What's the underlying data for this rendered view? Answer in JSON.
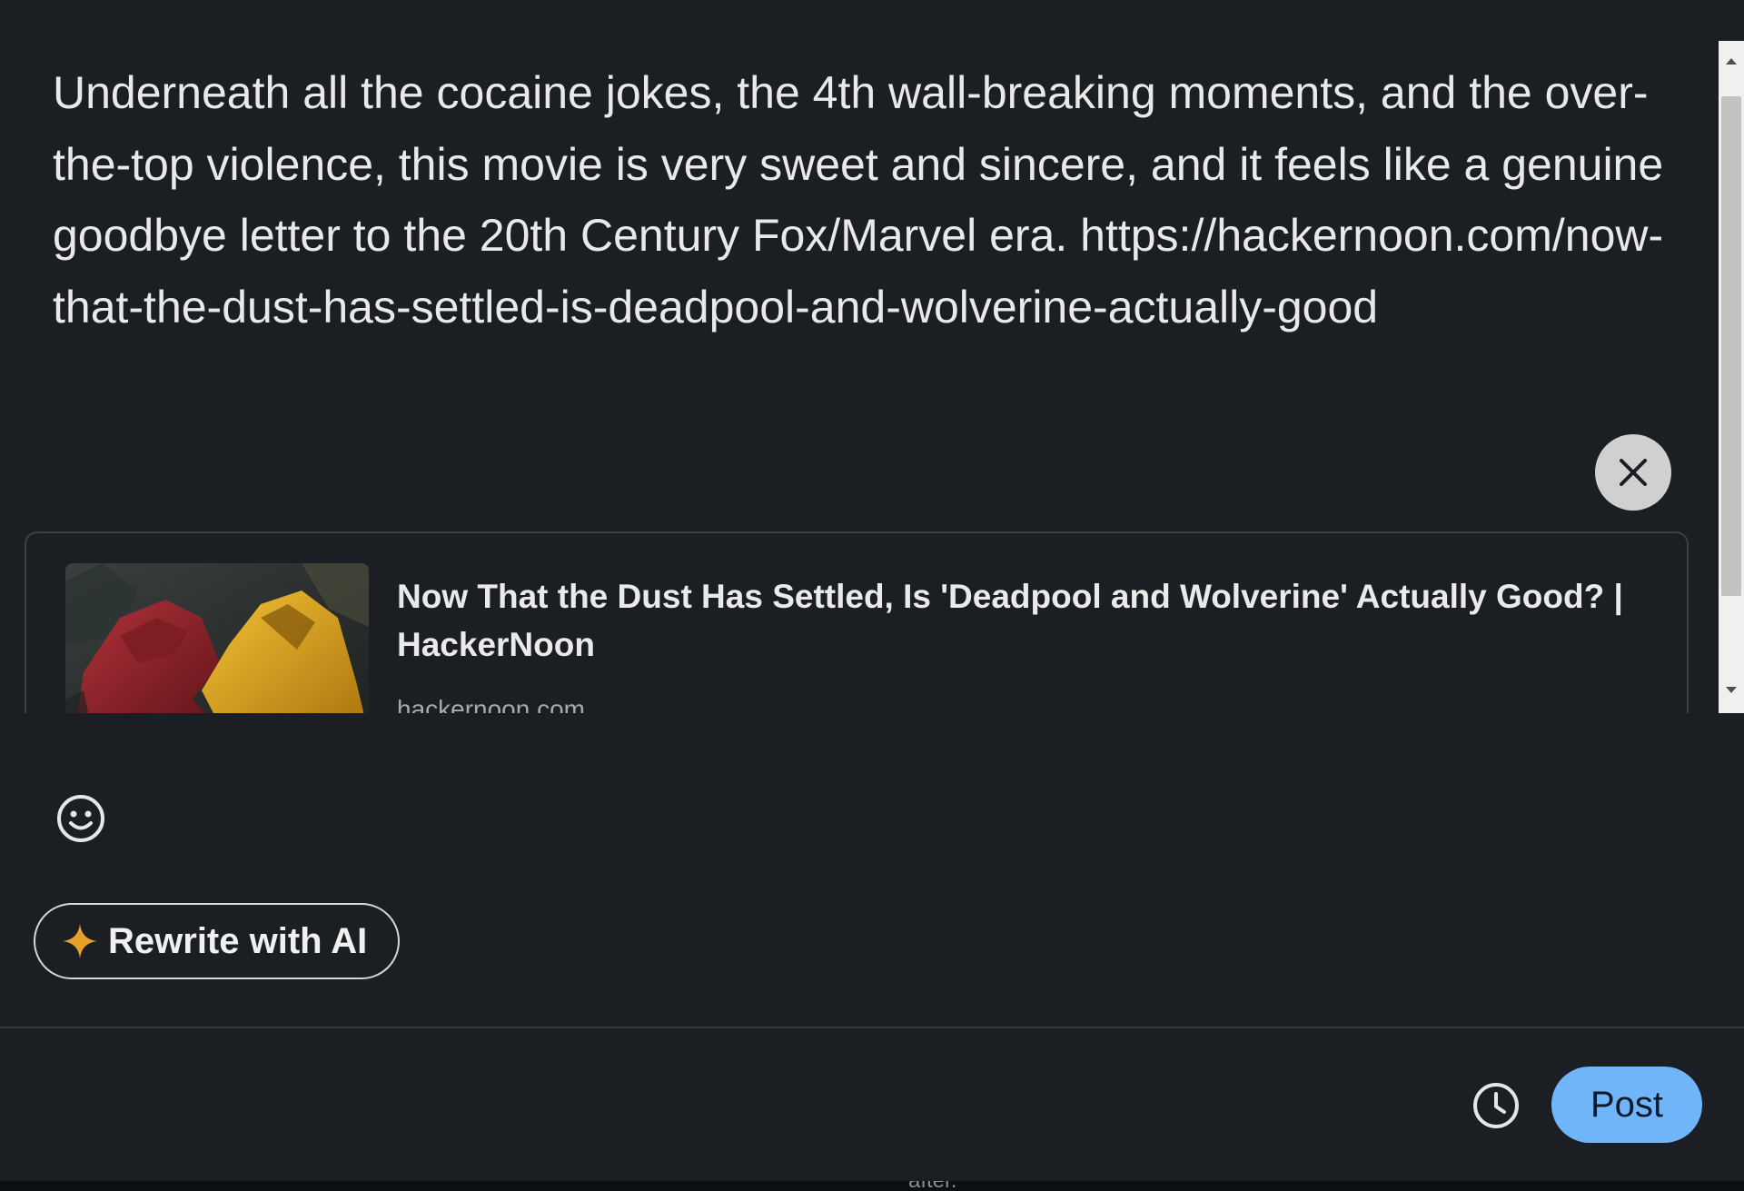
{
  "post": {
    "text": "Underneath all the cocaine jokes, the 4th wall-breaking moments, and the over-the-top violence, this movie is very sweet and sincere, and it feels like a genuine goodbye letter to the 20th Century Fox/Marvel era. https://hackernoon.com/now-that-the-dust-has-settled-is-deadpool-and-wolverine-actually-good"
  },
  "link_preview": {
    "title": "Now That the Dust Has Settled, Is 'Deadpool and Wolverine' Actually Good? | HackerNoon",
    "domain": "hackernoon.com",
    "thumbnail_icon": "deadpool-wolverine-heart-hands-image",
    "remove_icon": "close-icon"
  },
  "toolbar": {
    "emoji_icon": "smiley-icon",
    "ai_button_label": "Rewrite with AI",
    "ai_icon": "sparkle-icon"
  },
  "footer": {
    "schedule_icon": "clock-icon",
    "post_label": "Post"
  },
  "background_peek_text": "after.",
  "colors": {
    "background": "#1b1f23",
    "post_button": "#70b5f9",
    "sparkle": "#e8a02b"
  }
}
